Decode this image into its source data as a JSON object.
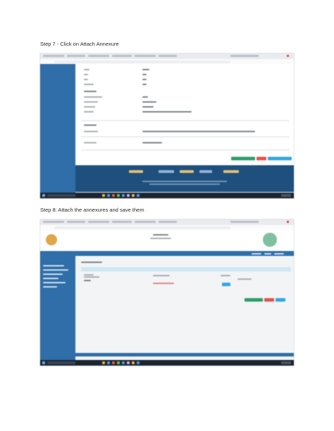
{
  "steps": [
    {
      "heading": "Step 7 - Click on Attach Annexure"
    },
    {
      "heading": "Step 8: Attach the annexures and save them"
    }
  ],
  "colors": {
    "sidebar": "#2f6ea8",
    "save_button": "#2e9e6a",
    "cancel_button": "#e0554f",
    "attach_button": "#35a7de",
    "footer": "#1f4f7d",
    "taskbar": "#1c2430"
  }
}
